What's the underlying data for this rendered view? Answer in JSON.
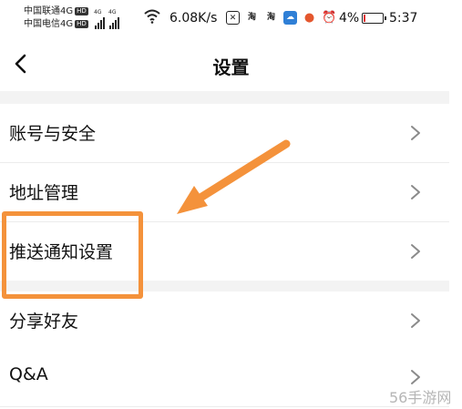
{
  "status_bar": {
    "carrier_1": "中国联通4G",
    "carrier_2": "中国电信4G",
    "hd_badge": "HD",
    "net_tag": "4G",
    "speed": "6.08K/s",
    "battery_percent": "4%",
    "battery_level": 0.04,
    "time": "5:37",
    "icons": [
      "signal-icon",
      "signal-icon",
      "wifi-icon",
      "capcut-icon",
      "taobao-icon",
      "taobao-icon",
      "cloud-app-icon",
      "reddit-icon",
      "alarm-icon",
      "battery-icon"
    ]
  },
  "header": {
    "title": "设置",
    "back_icon": "chevron-left-icon"
  },
  "settings": {
    "items": [
      {
        "label": "账号与安全"
      },
      {
        "label": "地址管理"
      },
      {
        "label": "推送通知设置"
      },
      {
        "label": "分享好友"
      },
      {
        "label": "Q&A"
      }
    ]
  },
  "annotation": {
    "highlight_target": "推送通知设置",
    "color": "#f4923b"
  },
  "watermark": "56手游网",
  "colors": {
    "background": "#ffffff",
    "section_gap": "#f3f3f3",
    "text": "#111111",
    "chevron": "#8a8a8a",
    "annotation": "#f4923b",
    "battery_low": "#e23030"
  }
}
